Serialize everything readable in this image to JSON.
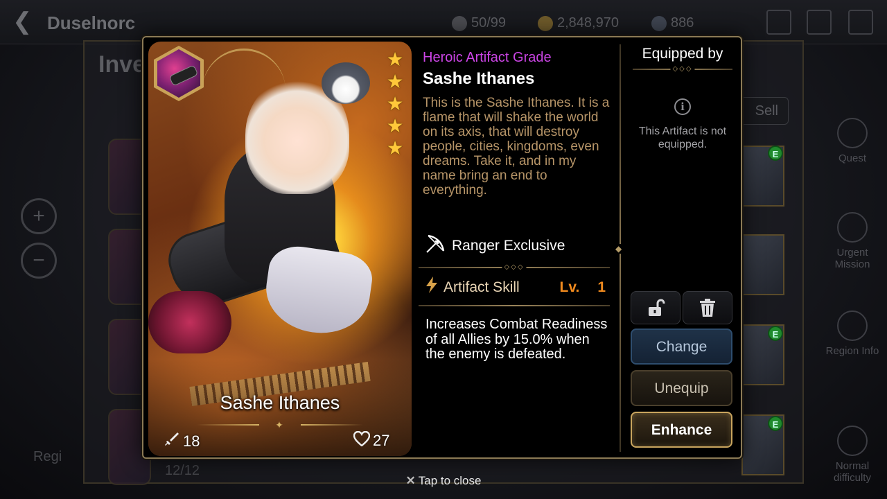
{
  "background": {
    "title": "Duselnorc",
    "resources": [
      "50/99",
      "2,848,970",
      "886"
    ],
    "inventory_label": "Inven",
    "sell_label": "Sell",
    "count_label": "12/12",
    "region_label": "Regi",
    "side_menu": [
      "Quest",
      "Urgent Mission",
      "Region Info",
      "Normal difficulty"
    ],
    "badge": "E"
  },
  "card": {
    "name": "Sashe Ithanes",
    "attack": "18",
    "health": "27",
    "stars": 5
  },
  "info": {
    "grade": "Heroic Artifact Grade",
    "name": "Sashe Ithanes",
    "description": "This is the Sashe Ithanes. It is a flame that will shake the world on its axis, that will destroy people, cities, kingdoms, even dreams. Take it, and in my name bring an end to everything.",
    "exclusive": "Ranger Exclusive",
    "skill_label": "Artifact Skill",
    "level_label": "Lv.",
    "level_value": "1",
    "skill_description": "Increases Combat Readiness of all Allies by 15.0% when the enemy is defeated."
  },
  "equipped": {
    "title": "Equipped by",
    "status": "This Artifact is not equipped."
  },
  "buttons": {
    "change": "Change",
    "unequip": "Unequip",
    "enhance": "Enhance"
  },
  "tap_close": "Tap to close",
  "colors": {
    "grade": "#cc45e6",
    "description": "#b79568",
    "level": "#f08a1e",
    "frame_gold": "#c9a55e"
  }
}
